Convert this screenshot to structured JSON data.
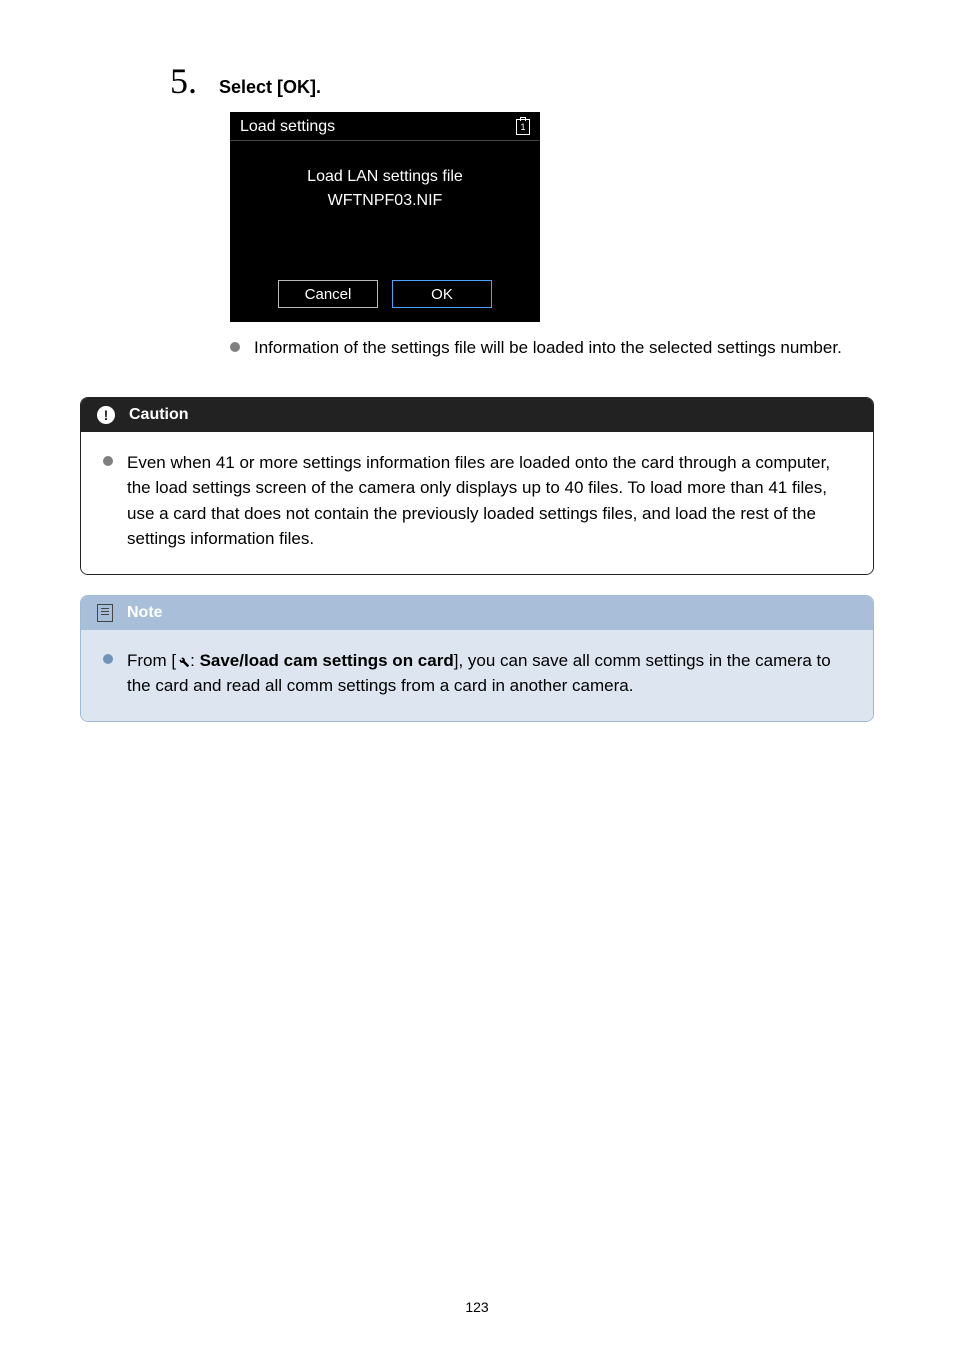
{
  "step": {
    "number": "5.",
    "title": "Select [OK]."
  },
  "screenshot": {
    "header_title": "Load settings",
    "card_badge": "1",
    "line1": "Load LAN settings file",
    "line2": "WFTNPF03.NIF",
    "cancel": "Cancel",
    "ok": "OK"
  },
  "post_bullet": "Information of the settings file will be loaded into the selected settings number.",
  "caution": {
    "title": "Caution",
    "text": "Even when 41 or more settings information files are loaded onto the card through a computer, the load settings screen of the camera only displays up to 40 files. To load more than 41 files, use a card that does not contain the previously loaded settings files, and load the rest of the settings information files."
  },
  "note": {
    "title": "Note",
    "prefix": "From [",
    "bold": "Save/load cam settings on card",
    "suffix": "], you can save all comm settings in the camera to the card and read all comm settings from a card in another camera.",
    "colon": ": "
  },
  "page_number": "123"
}
